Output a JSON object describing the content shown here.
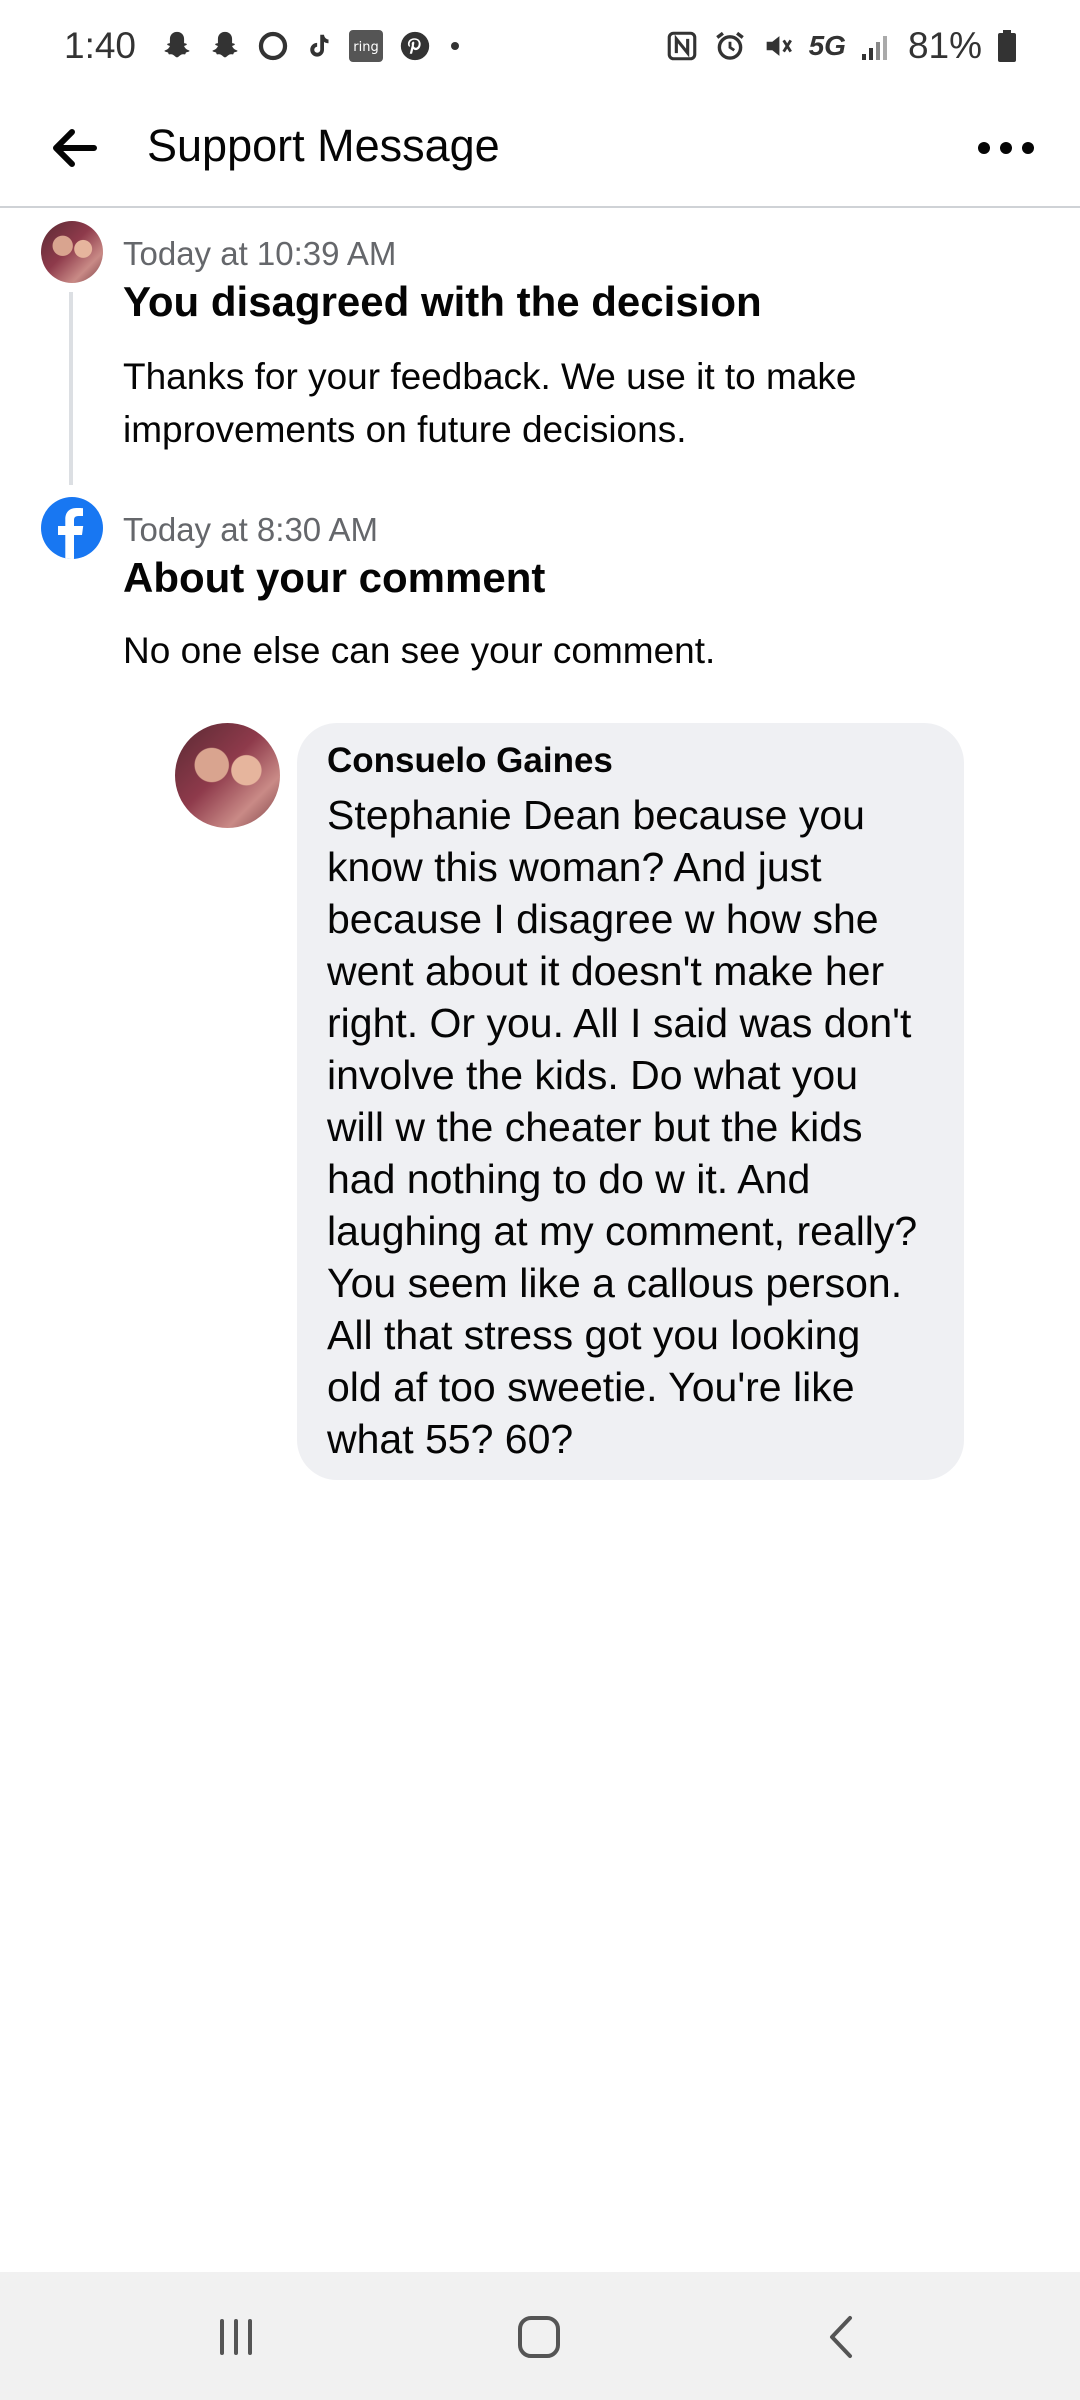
{
  "status_bar": {
    "time": "1:40",
    "notification_icons": [
      "snapchat-icon",
      "snapchat-icon",
      "circle-app-icon",
      "tiktok-icon",
      "ring-icon",
      "pinterest-icon",
      "more-dot-icon"
    ],
    "ring_label": "ring",
    "network": "5G",
    "battery": "81%"
  },
  "header": {
    "title": "Support Message"
  },
  "messages": [
    {
      "timestamp": "Today at 10:39 AM",
      "heading": "You disagreed with the decision",
      "body": "Thanks for your feedback. We use it to make improvements on future decisions."
    },
    {
      "timestamp": "Today at 8:30 AM",
      "heading": "About your comment",
      "body": "No one else can see your comment."
    }
  ],
  "comment": {
    "author": "Consuelo Gaines",
    "text": "Stephanie Dean because you\nknow this woman? And just\nbecause I disagree w how she\nwent about it doesn't make her\nright.  Or you. All I said was don't\ninvolve the kids. Do what you\nwill w the cheater but the kids\nhad nothing to do w it. And\nlaughing at my comment, really?\nYou seem like a callous person.\nAll that stress got you looking\nold af too sweetie. You're like\nwhat 55? 60?"
  },
  "colors": {
    "facebook_blue": "#1877f2",
    "bubble_bg": "#eff0f3",
    "secondary_text": "#65676b"
  }
}
